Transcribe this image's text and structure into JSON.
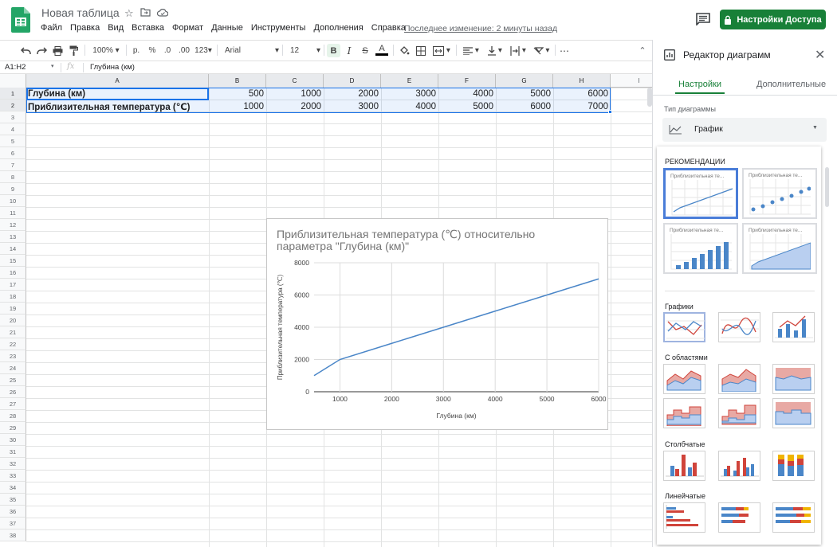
{
  "app": {
    "doc_title": "Новая таблица",
    "menu": [
      "Файл",
      "Правка",
      "Вид",
      "Вставка",
      "Формат",
      "Данные",
      "Инструменты",
      "Дополнения",
      "Справка"
    ],
    "last_edit": "Последнее изменение: 2 минуты назад",
    "share_label": "Настройки Доступа",
    "brand_color": "#188038"
  },
  "toolbar": {
    "zoom": "100%",
    "currency": "р.",
    "percent": "%",
    "decrease_decimals": ".0",
    "increase_decimals": ".00",
    "more_formats": "123",
    "font": "Arial",
    "font_size": "12",
    "bold": "B",
    "italic": "I",
    "strike": "S",
    "text_color": "A",
    "more": "⋯"
  },
  "formula_bar": {
    "name_box": "A1:H2",
    "fx": "fx",
    "value": "Глубина (км)"
  },
  "grid": {
    "columns": [
      "A",
      "B",
      "C",
      "D",
      "E",
      "F",
      "G",
      "H",
      "I"
    ],
    "rows": [
      "1",
      "2",
      "3",
      "4",
      "5",
      "6",
      "7",
      "8",
      "9",
      "10",
      "11",
      "12",
      "13",
      "14",
      "15",
      "16",
      "17",
      "18",
      "19",
      "20",
      "21",
      "22",
      "23",
      "24",
      "25",
      "26",
      "27",
      "28",
      "29",
      "30",
      "31",
      "32",
      "33",
      "34",
      "35",
      "36",
      "37",
      "38"
    ],
    "row1": {
      "label": "Глубина (км)",
      "values": [
        "500",
        "1000",
        "2000",
        "3000",
        "4000",
        "5000",
        "6000"
      ]
    },
    "row2": {
      "label": "Приблизительная температура (℃)",
      "values": [
        "1000",
        "2000",
        "3000",
        "4000",
        "5000",
        "6000",
        "7000"
      ]
    }
  },
  "chart": {
    "title_line1": "Приблизительная температура (℃) относительно",
    "title_line2": "параметра \"Глубина (км)\""
  },
  "chart_data": {
    "type": "line",
    "title": "Приблизительная температура (℃) относительно параметра \"Глубина (км)\"",
    "xlabel": "Глубина (км)",
    "ylabel": "Приблизительная температура (℃)",
    "x": [
      500,
      1000,
      2000,
      3000,
      4000,
      5000,
      6000
    ],
    "series": [
      {
        "values": [
          1000,
          2000,
          3000,
          4000,
          5000,
          6000,
          7000
        ]
      }
    ],
    "x_ticks": [
      "1000",
      "2000",
      "3000",
      "4000",
      "5000",
      "6000"
    ],
    "y_ticks": [
      "0",
      "2000",
      "4000",
      "6000",
      "8000"
    ],
    "xlim": [
      500,
      6000
    ],
    "ylim": [
      0,
      8000
    ],
    "grid": true,
    "line_color": "#4a86c8"
  },
  "panel": {
    "title": "Редактор диаграмм",
    "tab_setup": "Настройки",
    "tab_customize": "Дополнительные",
    "chart_type_label": "Тип диаграммы",
    "chart_type_value": "График",
    "recommendations_heading": "РЕКОМЕНДАЦИИ",
    "rec_label": "Приблизительная те...",
    "line_heading": "Графики",
    "area_heading": "С областями",
    "column_heading": "Столбчатые",
    "bar_heading": "Линейчатые"
  }
}
